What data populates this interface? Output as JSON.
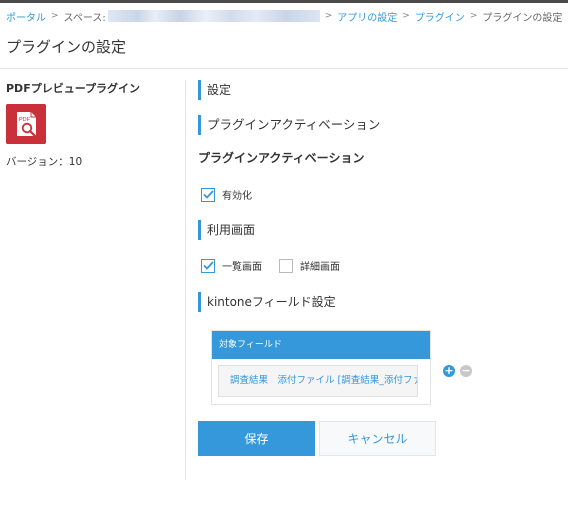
{
  "breadcrumb": {
    "portal": "ポータル",
    "space": "スペース:",
    "app_settings": "アプリの設定",
    "plugins": "プラグイン",
    "current": "プラグインの設定",
    "separator": ">"
  },
  "page": {
    "title": "プラグインの設定"
  },
  "plugin": {
    "name": "PDFプレビュープラグイン",
    "icon": "pdf-search-icon",
    "icon_label": "PDF",
    "icon_color": "#c9303a",
    "version": "バージョン：10"
  },
  "settings": {
    "heading": "設定",
    "activation_heading": "プラグインアクティベーション",
    "activation_subheading": "プラグインアクティベーション",
    "enabled": {
      "label": "有効化",
      "checked": true
    },
    "usage_heading": "利用画面",
    "screens": [
      {
        "label": "一覧画面",
        "checked": true
      },
      {
        "label": "詳細画面",
        "checked": false
      }
    ],
    "kintone_heading": "kintoneフィールド設定",
    "field_table": {
      "header": "対象フィールド",
      "value": "調査結果　添付ファイル [調査結果_添付ファ"
    },
    "row_actions": {
      "add": "+",
      "remove": "−"
    }
  },
  "buttons": {
    "save": "保存",
    "cancel": "キャンセル"
  },
  "colors": {
    "accent": "#3498db",
    "plugin_red": "#c9303a",
    "text": "#333333"
  }
}
